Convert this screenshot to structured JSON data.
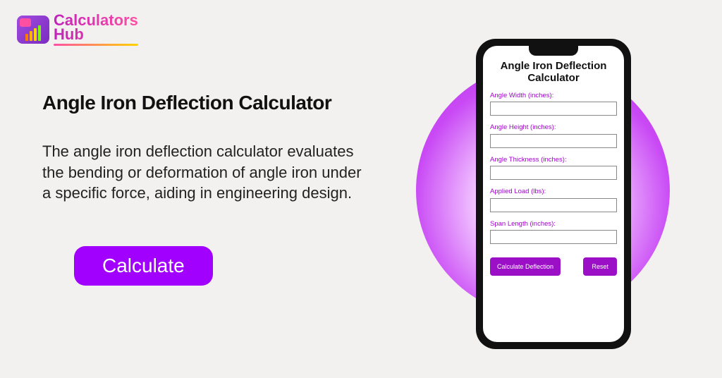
{
  "logo": {
    "line1": "Calculators",
    "line2": "Hub"
  },
  "content": {
    "title": "Angle Iron Deflection Calculator",
    "description": "The angle iron deflection calculator evaluates the bending or deformation of angle iron under a specific force, aiding in engineering design.",
    "cta_label": "Calculate"
  },
  "app": {
    "title": "Angle Iron Deflection Calculator",
    "fields": [
      {
        "label": "Angle Width (inches):",
        "value": ""
      },
      {
        "label": "Angle Height (inches):",
        "value": ""
      },
      {
        "label": "Angle Thickness (inches):",
        "value": ""
      },
      {
        "label": "Applied Load (lbs):",
        "value": ""
      },
      {
        "label": "Span Length (inches):",
        "value": ""
      }
    ],
    "calc_label": "Calculate Deflection",
    "reset_label": "Reset"
  },
  "colors": {
    "accent": "#a100ff",
    "app_accent": "#9b0fc7"
  }
}
